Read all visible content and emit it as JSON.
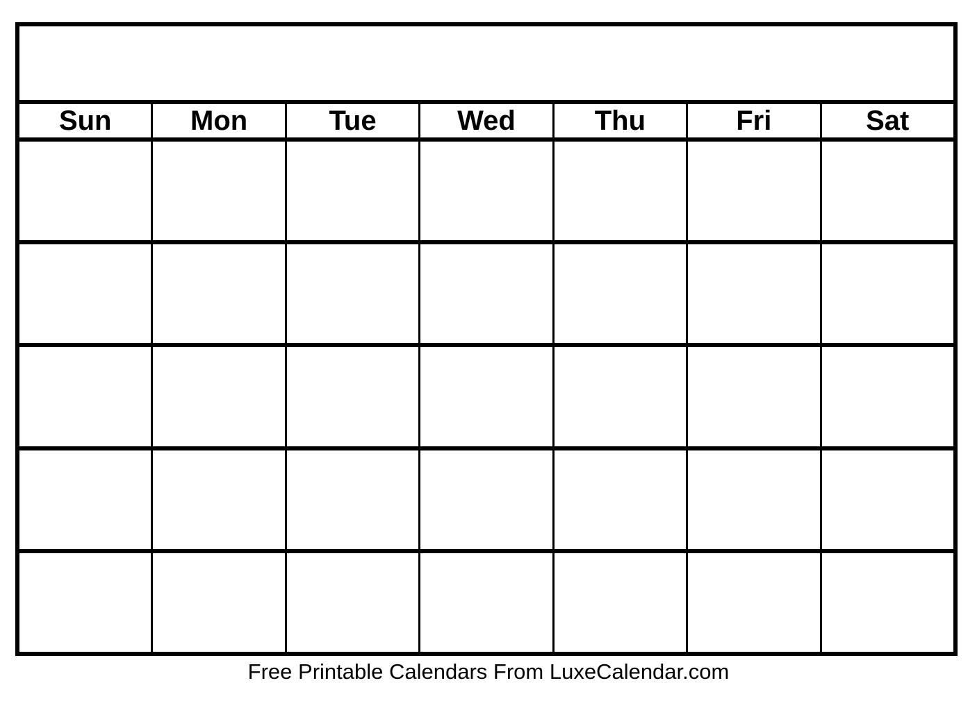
{
  "document": {
    "type": "blank-monthly-calendar-template",
    "title": "",
    "background_color": "#ffffff",
    "line_color": "#000000"
  },
  "calendar": {
    "title_bar": {
      "text": ""
    },
    "weekday_headers": [
      {
        "label": "Sun"
      },
      {
        "label": "Mon"
      },
      {
        "label": "Tue"
      },
      {
        "label": "Wed"
      },
      {
        "label": "Thu"
      },
      {
        "label": "Fri"
      },
      {
        "label": "Sat"
      }
    ],
    "weeks": [
      {
        "days": [
          {
            "number": ""
          },
          {
            "number": ""
          },
          {
            "number": ""
          },
          {
            "number": ""
          },
          {
            "number": ""
          },
          {
            "number": ""
          },
          {
            "number": ""
          }
        ]
      },
      {
        "days": [
          {
            "number": ""
          },
          {
            "number": ""
          },
          {
            "number": ""
          },
          {
            "number": ""
          },
          {
            "number": ""
          },
          {
            "number": ""
          },
          {
            "number": ""
          }
        ]
      },
      {
        "days": [
          {
            "number": ""
          },
          {
            "number": ""
          },
          {
            "number": ""
          },
          {
            "number": ""
          },
          {
            "number": ""
          },
          {
            "number": ""
          },
          {
            "number": ""
          }
        ]
      },
      {
        "days": [
          {
            "number": ""
          },
          {
            "number": ""
          },
          {
            "number": ""
          },
          {
            "number": ""
          },
          {
            "number": ""
          },
          {
            "number": ""
          },
          {
            "number": ""
          }
        ]
      },
      {
        "days": [
          {
            "number": ""
          },
          {
            "number": ""
          },
          {
            "number": ""
          },
          {
            "number": ""
          },
          {
            "number": ""
          },
          {
            "number": ""
          },
          {
            "number": ""
          }
        ]
      }
    ]
  },
  "footer": {
    "text": "Free Printable Calendars From LuxeCalendar.com"
  }
}
